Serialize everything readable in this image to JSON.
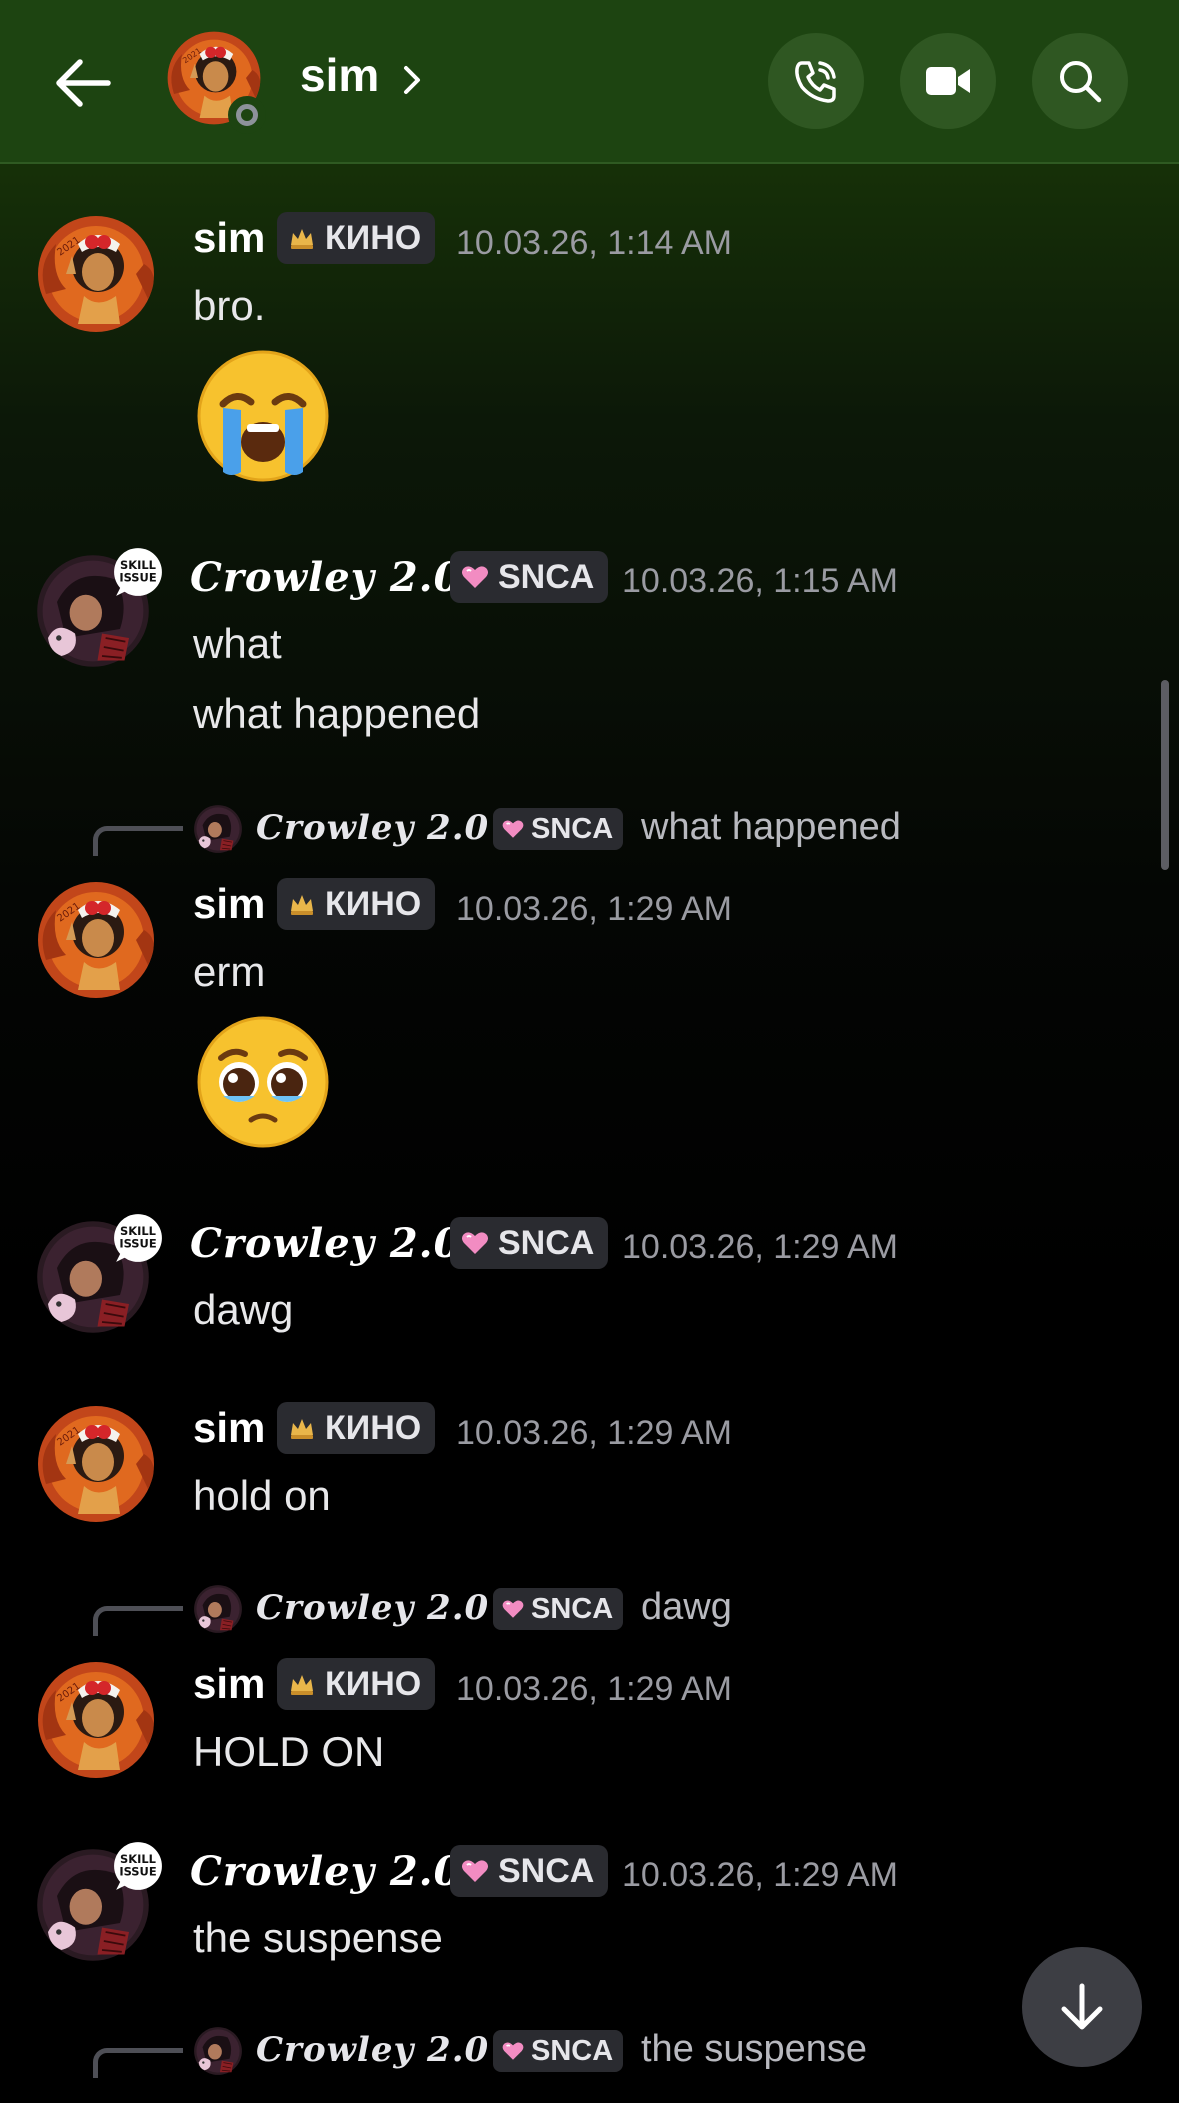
{
  "header": {
    "title": "sim",
    "back_icon": "arrow-left-icon",
    "call_icon": "phone-icon",
    "video_icon": "video-camera-icon",
    "search_icon": "search-icon",
    "status": "offline"
  },
  "tags": {
    "sim": "КИНО",
    "crowley": "SNCA"
  },
  "messages": [
    {
      "author": "sim",
      "tag": "КИНО",
      "timestamp": "10.03.26, 1:14 AM",
      "lines": [
        "bro."
      ],
      "emoji": "loudly-crying-face"
    },
    {
      "author": "Crowley 2.0",
      "tag": "SNCA",
      "timestamp": "10.03.26, 1:15 AM",
      "lines": [
        "what",
        "what happened"
      ]
    },
    {
      "reply_to": {
        "author": "Crowley 2.0",
        "tag": "SNCA",
        "text": "what happened"
      },
      "author": "sim",
      "tag": "КИНО",
      "timestamp": "10.03.26, 1:29 AM",
      "lines": [
        "erm"
      ],
      "emoji": "pleading-face"
    },
    {
      "author": "Crowley 2.0",
      "tag": "SNCA",
      "timestamp": "10.03.26, 1:29 AM",
      "lines": [
        "dawg"
      ]
    },
    {
      "author": "sim",
      "tag": "КИНО",
      "timestamp": "10.03.26, 1:29 AM",
      "lines": [
        "hold on"
      ]
    },
    {
      "reply_to": {
        "author": "Crowley 2.0",
        "tag": "SNCA",
        "text": "dawg"
      },
      "author": "sim",
      "tag": "КИНО",
      "timestamp": "10.03.26, 1:29 AM",
      "lines": [
        "HOLD ON"
      ]
    },
    {
      "author": "Crowley 2.0",
      "tag": "SNCA",
      "timestamp": "10.03.26, 1:29 AM",
      "lines": [
        "the suspense"
      ]
    },
    {
      "reply_to": {
        "author": "Crowley 2.0",
        "tag": "SNCA",
        "text": "the suspense"
      }
    }
  ],
  "scroll_down_icon": "arrow-down-icon",
  "colors": {
    "header_bg": "#1d4411",
    "tag_bg": "#2a2b30",
    "timestamp": "#9a9ba2"
  }
}
